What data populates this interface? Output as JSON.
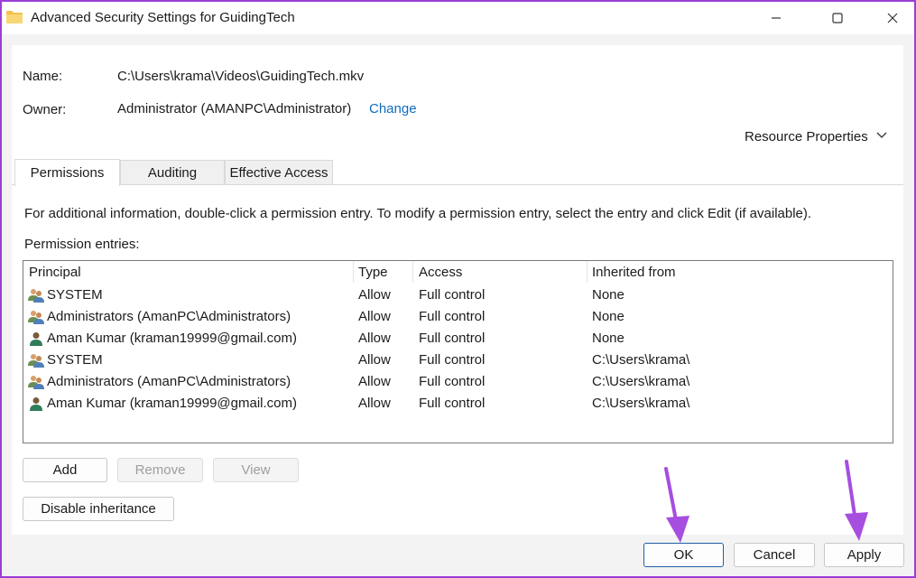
{
  "window": {
    "title": "Advanced Security Settings for GuidingTech"
  },
  "info": {
    "name_label": "Name:",
    "name_value": "C:\\Users\\krama\\Videos\\GuidingTech.mkv",
    "owner_label": "Owner:",
    "owner_value": "Administrator (AMANPC\\Administrator)",
    "change_link": "Change",
    "resource_properties": "Resource Properties"
  },
  "tabs": [
    {
      "label": "Permissions",
      "active": true
    },
    {
      "label": "Auditing",
      "active": false
    },
    {
      "label": "Effective Access",
      "active": false
    }
  ],
  "permissions": {
    "description": "For additional information, double-click a permission entry. To modify a permission entry, select the entry and click Edit (if available).",
    "entries_label": "Permission entries:",
    "columns": [
      "Principal",
      "Type",
      "Access",
      "Inherited from"
    ],
    "rows": [
      {
        "principal": "SYSTEM",
        "icon": "group-users-icon",
        "type": "Allow",
        "access": "Full control",
        "inherited": "None"
      },
      {
        "principal": "Administrators (AmanPC\\Administrators)",
        "icon": "group-users-icon",
        "type": "Allow",
        "access": "Full control",
        "inherited": "None"
      },
      {
        "principal": "Aman Kumar (kraman19999@gmail.com)",
        "icon": "user-icon",
        "type": "Allow",
        "access": "Full control",
        "inherited": "None"
      },
      {
        "principal": "SYSTEM",
        "icon": "group-users-icon",
        "type": "Allow",
        "access": "Full control",
        "inherited": "C:\\Users\\krama\\"
      },
      {
        "principal": "Administrators (AmanPC\\Administrators)",
        "icon": "group-users-icon",
        "type": "Allow",
        "access": "Full control",
        "inherited": "C:\\Users\\krama\\"
      },
      {
        "principal": "Aman Kumar (kraman19999@gmail.com)",
        "icon": "user-icon",
        "type": "Allow",
        "access": "Full control",
        "inherited": "C:\\Users\\krama\\"
      }
    ]
  },
  "buttons": {
    "add": "Add",
    "remove": "Remove",
    "view": "View",
    "disable_inheritance": "Disable inheritance",
    "ok": "OK",
    "cancel": "Cancel",
    "apply": "Apply"
  },
  "colors": {
    "frame": "#9a3fd6",
    "link": "#0f6cbd",
    "annotation_arrow": "#a64ee0"
  }
}
